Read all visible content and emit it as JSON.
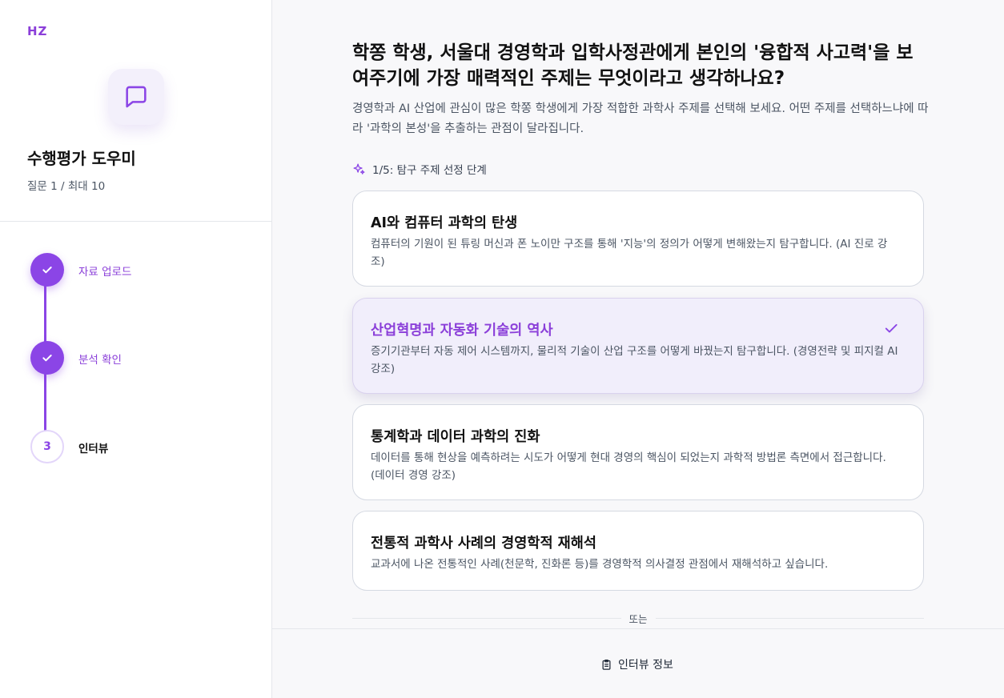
{
  "app": {
    "logo": "HZ",
    "title": "수행평가 도우미",
    "question_count": "질문 1 / 최대 10"
  },
  "steps": [
    {
      "label": "자료 업로드",
      "status": "done"
    },
    {
      "label": "분석 확인",
      "status": "done"
    },
    {
      "number": "3",
      "label": "인터뷰",
      "status": "current"
    }
  ],
  "main": {
    "question": "학쫑 학생, 서울대 경영학과 입학사정관에게 본인의 '융합적 사고력'을 보여주기에 가장 매력적인 주제는 무엇이라고 생각하나요?",
    "description": "경영학과 AI 산업에 관심이 많은 학쫑 학생에게 가장 적합한 과학사 주제를 선택해 보세요. 어떤 주제를 선택하느냐에 따라 '과학의 본성'을 추출하는 관점이 달라집니다.",
    "stage": "1/5: 탐구 주제 선정 단계",
    "options": [
      {
        "title": "AI와 컴퓨터 과학의 탄생",
        "description": "컴퓨터의 기원이 된 튜링 머신과 폰 노이만 구조를 통해 '지능'의 정의가 어떻게 변해왔는지 탐구합니다. (AI 진로 강조)",
        "selected": false
      },
      {
        "title": "산업혁명과 자동화 기술의 역사",
        "description": "증기기관부터 자동 제어 시스템까지, 물리적 기술이 산업 구조를 어떻게 바꿨는지 탐구합니다. (경영전략 및 피지컬 AI 강조)",
        "selected": true
      },
      {
        "title": "통계학과 데이터 과학의 진화",
        "description": "데이터를 통해 현상을 예측하려는 시도가 어떻게 현대 경영의 핵심이 되었는지 과학적 방법론 측면에서 접근합니다. (데이터 경영 강조)",
        "selected": false
      },
      {
        "title": "전통적 과학사 사례의 경영학적 재해석",
        "description": "교과서에 나온 전통적인 사례(천문학, 진화론 등)를 경영학적 의사결정 관점에서 재해석하고 싶습니다.",
        "selected": false
      }
    ],
    "or_text": "또는"
  },
  "footer": {
    "interview_info": "인터뷰 정보"
  },
  "colors": {
    "accent": "#8b45e6",
    "selected_bg": "#f1eefb",
    "border": "#d5d9e2"
  }
}
